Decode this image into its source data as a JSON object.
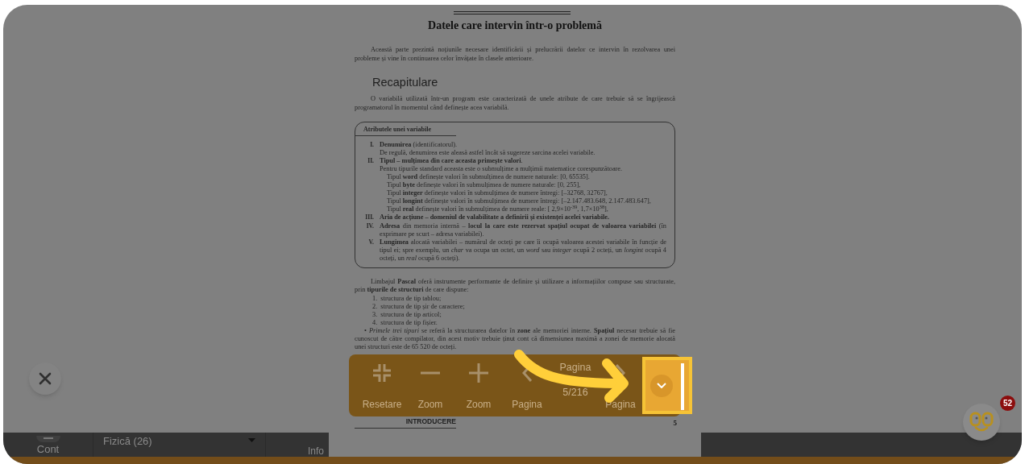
{
  "document": {
    "title": "Datele care intervin într-o problemă",
    "intro": "Această parte prezintă noțiunile necesare identificării și prelucrării datelor ce intervin în rezolvarea unei probleme și vine în continuarea celor învățate în clasele anterioare.",
    "section_heading": "Recapitulare",
    "section_text": "O variabilă utilizată într-un program este caracterizată de unele atribute de care trebuie să se îngrijească programatorul în momentul când definește acea variabilă.",
    "box": {
      "title": "Atributele unei variabile",
      "items": [
        {
          "numeral": "I.",
          "text": "**Denumirea** (identificatorul).",
          "detail": "De regulă, denumirea este aleasă astfel încât să sugereze sarcina acelei variabile."
        },
        {
          "numeral": "II.",
          "text": "**Tipul – mulțimea din care aceasta primește valori**.",
          "detail": "Pentru tipurile standard aceasta este o submulțime a mulțimii matematice corespunzătoare.",
          "children": [
            "Tipul **word** definește valori în submulțimea de numere naturale: [0, 65535].",
            "Tipul **byte** definește valori în submulțimea de numere naturale: [0, 255],",
            "Tipul **integer** definește valori în submulțimea de numere întregi: [–32768, 32767],",
            "Tipul **longint** definește valori în submulțimea de numere întregi: [–2.147.483.648, 2.147.483.647],",
            "Tipul **real** definește valori în submulțimea de numere reale: [ 2,9×10$^{-39}$, 1,7×10$^{38}$],"
          ]
        },
        {
          "numeral": "III.",
          "text": "**Aria de acțiune – domeniul de valabilitate a definirii și existenței acelei variabile.**"
        },
        {
          "numeral": "IV.",
          "text": "**Adresa** din memoria internă  – **locul la care este rezervat spațiul ocupat de valoarea variabilei** (în exprimare pe scurt – adresa variabilei)."
        },
        {
          "numeral": "V.",
          "text": "**Lungimea** alocată variabilei – numărul de octeți pe care îi ocupă valoarea acestei variabile în funcție de tipul ei; spre exemplu, un *char* va ocupa un octet, un *word* sau *integer* ocupă 2 octeți, un *longint* ocupă 4 octeți, un *real* ocupă 6 octeți)."
        }
      ]
    },
    "paragraph": "Limbajul **Pascal** oferă instrumente performante de definire și utilizare a informațiilor compuse sau structurate, prin **tipurile de structuri** de care dispune:",
    "list": [
      "1.  structura de tip tablou;",
      "2.  structura de tip șir de caractere;",
      "3.  structura de tip articol;",
      "4.  structura de tip fișier."
    ],
    "bullets": [
      "• *Primele trei tipuri* se referă la structurarea datelor în **zone** ale memoriei interne. **Spațiul** necesar trebuie să fie cunoscut de către compilator, din acest motiv trebuie ținut cont că dimensiunea maximă a zonei de memorie alocată unei structuri este de 65 520 de octeți."
    ],
    "footer_label": "INTRODUCERE",
    "page_number": "5"
  },
  "viewer_toolbar": {
    "items": [
      {
        "kind": "reset",
        "label": "Resetare",
        "highlighted": false
      },
      {
        "kind": "zoom-out",
        "label": "Zoom",
        "highlighted": false
      },
      {
        "kind": "zoom-in",
        "label": "Zoom",
        "highlighted": false
      },
      {
        "kind": "prev",
        "label": "Pagina",
        "highlighted": false
      },
      {
        "kind": "page-indicator",
        "label": "Pagina",
        "value": "5/216",
        "highlighted": false
      },
      {
        "kind": "next",
        "label": "Pagina",
        "highlighted": false
      },
      {
        "kind": "dropdown",
        "highlighted": true
      }
    ]
  },
  "background_bar": {
    "account_label": "Cont",
    "category_select": "Fizică (26)",
    "info_label": "Info"
  },
  "chat_widget": {
    "badge": "52"
  }
}
